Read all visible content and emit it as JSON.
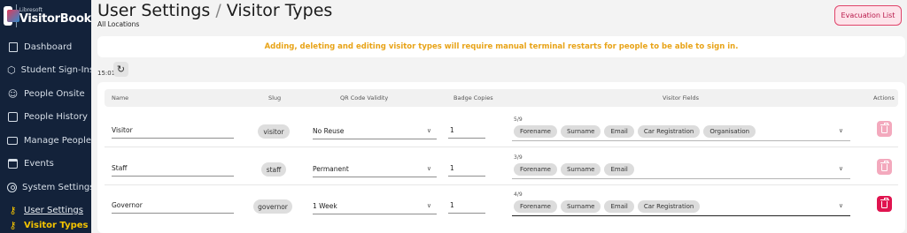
{
  "brand": {
    "company": "Libresoft",
    "name": "VisitorBook"
  },
  "sidebar": {
    "items": [
      {
        "label": "Dashboard",
        "icon": "dashboard-icon"
      },
      {
        "label": "Student Sign-Ins",
        "icon": "student-signin-icon"
      },
      {
        "label": "People Onsite",
        "icon": "people-onsite-icon"
      },
      {
        "label": "People History",
        "icon": "people-history-icon"
      },
      {
        "label": "Manage People",
        "icon": "manage-people-icon"
      },
      {
        "label": "Events",
        "icon": "events-icon"
      },
      {
        "label": "System Settings",
        "icon": "settings-icon"
      }
    ],
    "subitems": [
      {
        "label": "User Settings",
        "icon": "key-icon"
      },
      {
        "label": "Visitor Types",
        "icon": "key-icon",
        "active": true
      }
    ]
  },
  "header": {
    "title": "User Settings",
    "separator": "/",
    "subtitle_part": "Visitor Types",
    "location": "All Locations",
    "evacuation_label": "Evacuation List"
  },
  "banner": {
    "text": "Adding, deleting and editing visitor types will require manual terminal restarts for people to be able to sign in."
  },
  "toolbar": {
    "time": "15:01",
    "refresh_icon": "refresh-icon"
  },
  "table": {
    "headers": {
      "name": "Name",
      "slug": "Slug",
      "qr": "QR Code Validity",
      "copies": "Badge Copies",
      "fields": "Visitor Fields",
      "actions": "Actions"
    },
    "rows": [
      {
        "name": "Visitor",
        "slug": "visitor",
        "qr": "No Reuse",
        "copies": "1",
        "count": "5/9",
        "fields": [
          "Forename",
          "Surname",
          "Email",
          "Car Registration",
          "Organisation"
        ]
      },
      {
        "name": "Staff",
        "slug": "staff",
        "qr": "Permanent",
        "copies": "1",
        "count": "3/9",
        "fields": [
          "Forename",
          "Surname",
          "Email"
        ]
      },
      {
        "name": "Governor",
        "slug": "governor",
        "qr": "1 Week",
        "copies": "1",
        "count": "4/9",
        "fields": [
          "Forename",
          "Surname",
          "Email",
          "Car Registration"
        ]
      }
    ]
  },
  "colors": {
    "sidebar_bg": "#13223a",
    "accent_yellow": "#f5c400",
    "banner_text": "#e8a317",
    "delete_strong": "#e0144f",
    "delete_muted": "#f3a9bd",
    "evac_border": "#e0446a"
  }
}
